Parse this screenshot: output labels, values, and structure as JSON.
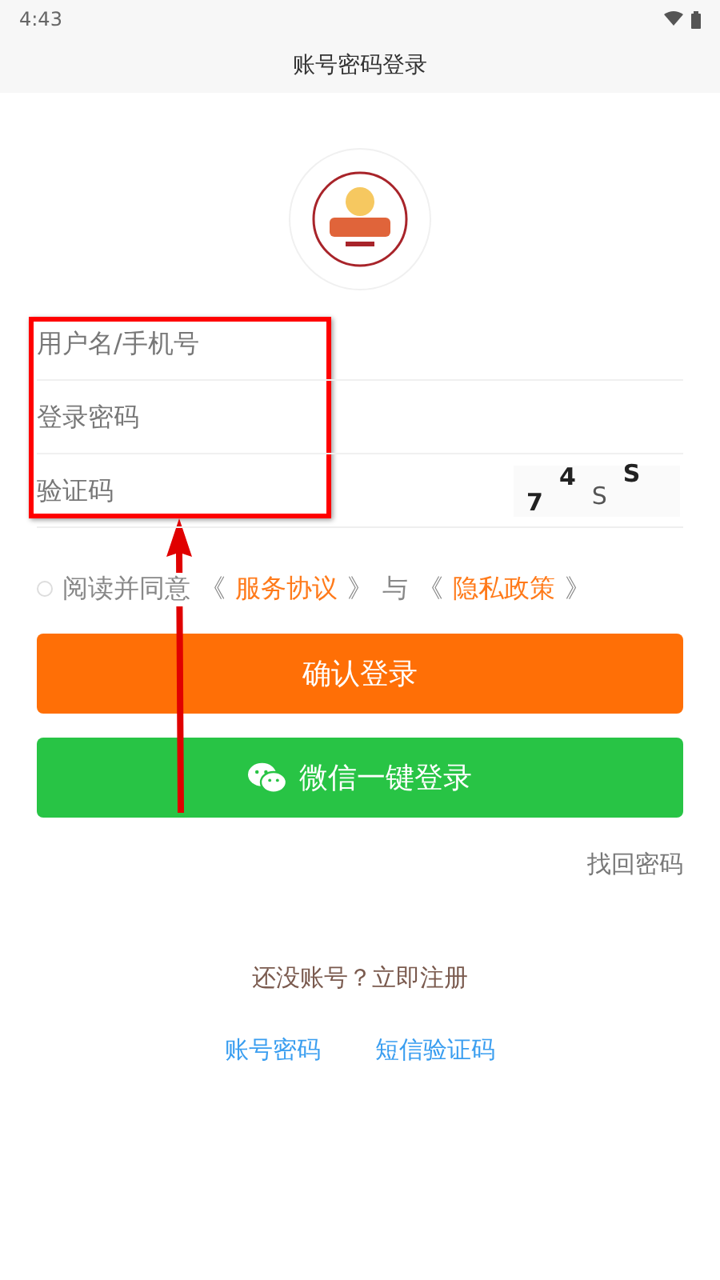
{
  "status_bar": {
    "time": "4:43"
  },
  "header": {
    "title": "账号密码登录"
  },
  "fields": [
    {
      "placeholder": "用户名/手机号",
      "kind": "text"
    },
    {
      "placeholder": "登录密码",
      "kind": "password"
    },
    {
      "placeholder": "验证码",
      "kind": "captcha",
      "captcha": [
        "7",
        "4",
        "S",
        "S"
      ]
    }
  ],
  "agreement": {
    "checked": false,
    "parts": [
      {
        "kind": "text",
        "text": "阅读并同意"
      },
      {
        "kind": "text",
        "text": "《"
      },
      {
        "kind": "link",
        "text": "服务协议"
      },
      {
        "kind": "text",
        "text": "》"
      },
      {
        "kind": "text",
        "text": "与"
      },
      {
        "kind": "text",
        "text": "《"
      },
      {
        "kind": "link",
        "text": "隐私政策"
      },
      {
        "kind": "text",
        "text": "》"
      }
    ]
  },
  "buttons": [
    {
      "kind": "primary",
      "label": "确认登录"
    },
    {
      "kind": "wechat",
      "label": "微信一键登录"
    }
  ],
  "forgot_link": "找回密码",
  "register_link": "还没账号？立即注册",
  "login_modes": [
    {
      "label": "账号密码"
    },
    {
      "label": "短信验证码"
    }
  ],
  "annotations": [
    {
      "kind": "box"
    },
    {
      "kind": "arrow"
    }
  ]
}
